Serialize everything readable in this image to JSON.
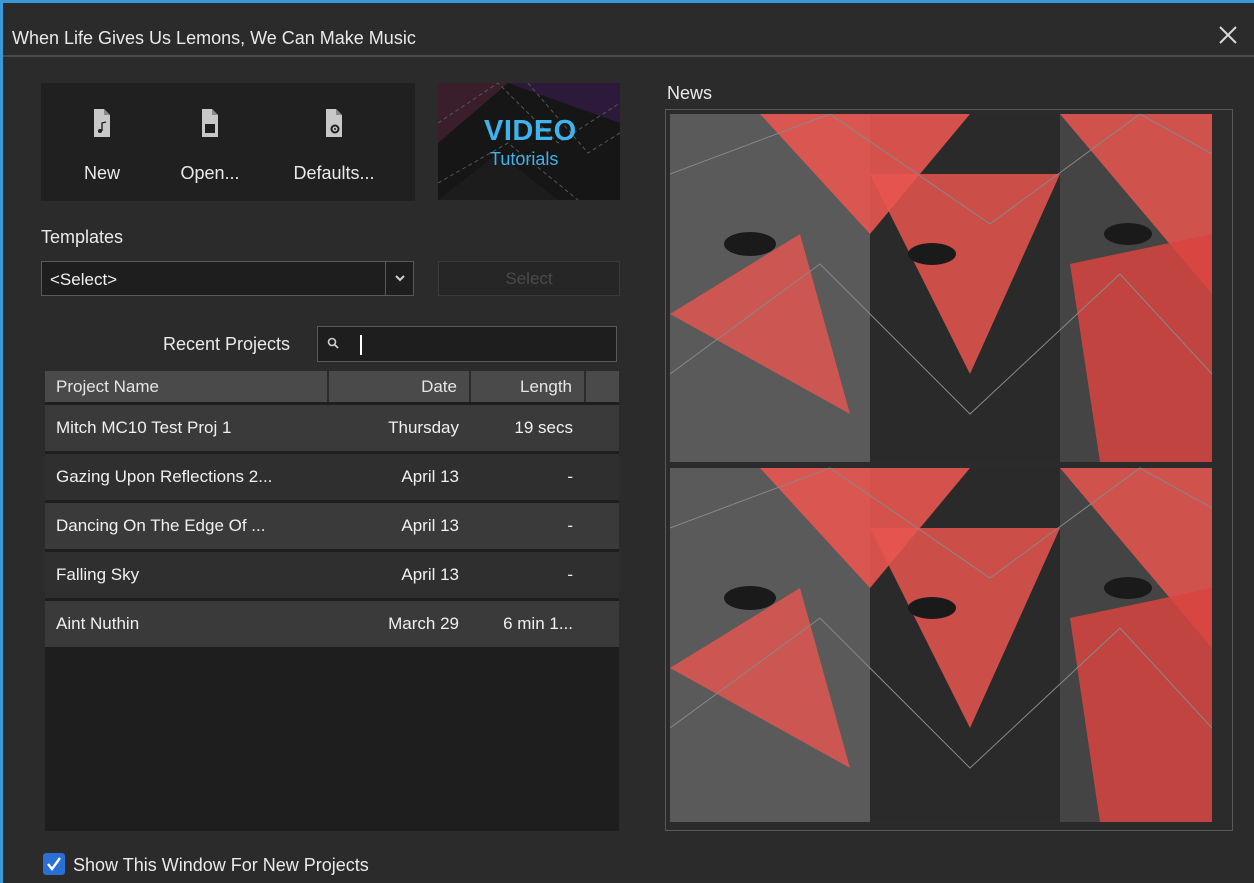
{
  "window": {
    "title": "When Life Gives Us Lemons, We Can Make Music"
  },
  "actions": [
    {
      "label": "New",
      "icon": "new-file-icon"
    },
    {
      "label": "Open...",
      "icon": "open-file-icon"
    },
    {
      "label": "Defaults...",
      "icon": "settings-file-icon"
    }
  ],
  "video_tile": {
    "line1": "VIDEO",
    "line2": "Tutorials"
  },
  "templates": {
    "label": "Templates",
    "selected": "<Select>",
    "button": "Select"
  },
  "recent": {
    "label": "Recent Projects",
    "search_value": "",
    "columns": [
      "Project Name",
      "Date",
      "Length"
    ],
    "rows": [
      {
        "name": "Mitch MC10 Test Proj 1",
        "date": "Thursday",
        "length": "19 secs"
      },
      {
        "name": "Gazing Upon Reflections 2...",
        "date": "April 13",
        "length": "-"
      },
      {
        "name": "Dancing On The Edge Of ...",
        "date": "April 13",
        "length": "-"
      },
      {
        "name": "Falling Sky",
        "date": "April 13",
        "length": "-"
      },
      {
        "name": "Aint Nuthin",
        "date": "March 29",
        "length": "6 min 1..."
      }
    ]
  },
  "news": {
    "label": "News"
  },
  "footer": {
    "checkbox_label": "Show This Window For New Projects",
    "checked": true
  },
  "colors": {
    "accent": "#3a9ad9",
    "video_text": "#3fb3ec",
    "news_red": "#e8554f"
  }
}
